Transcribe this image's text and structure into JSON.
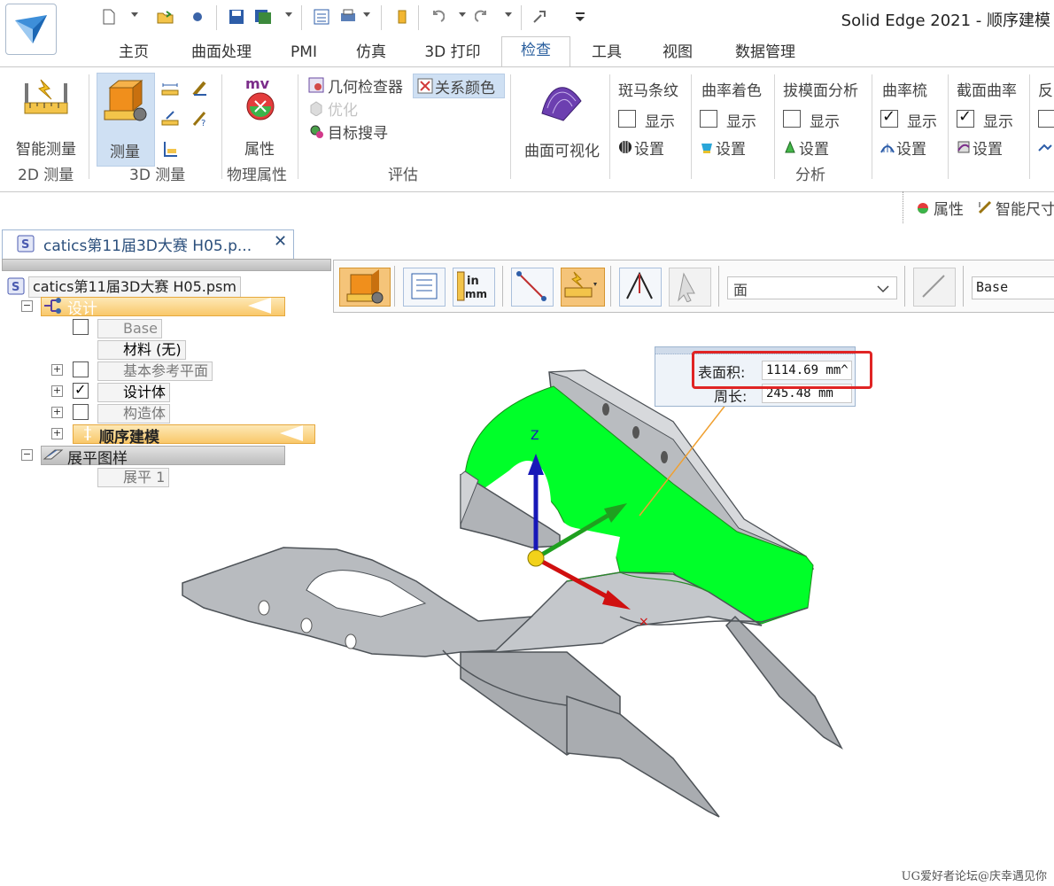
{
  "app": {
    "title": "Solid Edge 2021 - 顺序建模"
  },
  "tabs": [
    {
      "label": "主页"
    },
    {
      "label": "曲面处理"
    },
    {
      "label": "PMI"
    },
    {
      "label": "仿真"
    },
    {
      "label": "3D 打印"
    },
    {
      "label": "检查"
    },
    {
      "label": "工具"
    },
    {
      "label": "视图"
    },
    {
      "label": "数据管理"
    }
  ],
  "ribbon": {
    "smart_measure": "智能测量",
    "group_2d": "2D 测量",
    "measure": "测量",
    "group_3d": "3D 测量",
    "properties": "属性",
    "group_physical": "物理属性",
    "geometry_inspector": "几何检查器",
    "relation_colors": "关系颜色",
    "optimize": "优化",
    "target_search": "目标搜寻",
    "group_evaluate": "评估",
    "surface_visualize": "曲面可视化",
    "zebra": "斑马条纹",
    "curvature_shading": "曲率着色",
    "draft_analysis": "拔模面分析",
    "curvature_comb": "曲率梳",
    "section_curvature": "截面曲率",
    "reflect_partial": "反",
    "show": "显示",
    "settings": "设置",
    "group_analysis": "分析"
  },
  "minibar": {
    "properties": "属性",
    "smart_dim": "智能尺寸"
  },
  "document": {
    "tab_title": "catics第11届3D大赛 H05.p...",
    "close": "✕"
  },
  "tree": {
    "root": "catics第11届3D大赛 H05.psm",
    "design": "设计",
    "base": "Base",
    "material": "材料 (无)",
    "ref_planes": "基本参考平面",
    "design_body": "设计体",
    "construction": "构造体",
    "sequential": "顺序建模",
    "flat_pattern": "展平图样",
    "flat1": "展平 1"
  },
  "cmdbar": {
    "select_filter": "面",
    "base_field": "Base"
  },
  "measure": {
    "area_label": "表面积:",
    "area_value": "1114.69 mm^",
    "perimeter_label": "周长:",
    "perimeter_value": "245.48 mm"
  },
  "viewport": {
    "z_axis_label": "Z"
  },
  "watermark": "UG爱好者论坛@庆幸遇见你",
  "colors": {
    "highlight_face": "#00ff29",
    "part_gray": "#b9bcc0",
    "accent": "#2a5f9e"
  }
}
